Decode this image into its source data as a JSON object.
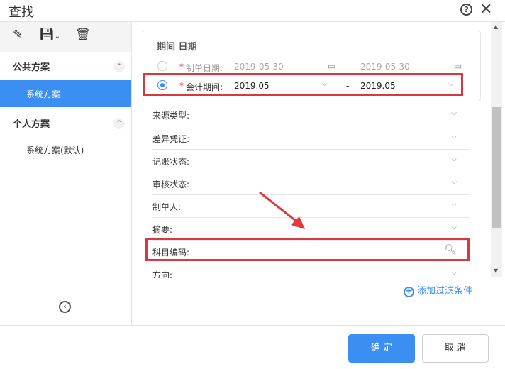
{
  "window": {
    "title": "查找"
  },
  "sidebar": {
    "groups": [
      {
        "label": "公共方案",
        "items": [
          "系统方案"
        ]
      },
      {
        "label": "个人方案",
        "items": [
          "系统方案(默认)"
        ]
      }
    ]
  },
  "period": {
    "title": "期间 日期",
    "rows": [
      {
        "label": "制单日期:",
        "from": "2019-05-30",
        "to": "2019-05-30",
        "selected": false
      },
      {
        "label": "会计期间:",
        "from": "2019.05",
        "to": "2019.05",
        "selected": true
      }
    ],
    "required": "*",
    "dash": "-"
  },
  "filters": [
    "来源类型:",
    "差异凭证:",
    "记账状态:",
    "审核状态:",
    "制单人:",
    "摘要:",
    "科目编码:",
    "方向:"
  ],
  "add_filter": "添加过滤条件",
  "footer": {
    "ok": "确 定",
    "cancel": "取 消"
  },
  "colors": {
    "accent": "#3b8ef2",
    "highlight": "#d8383f"
  }
}
